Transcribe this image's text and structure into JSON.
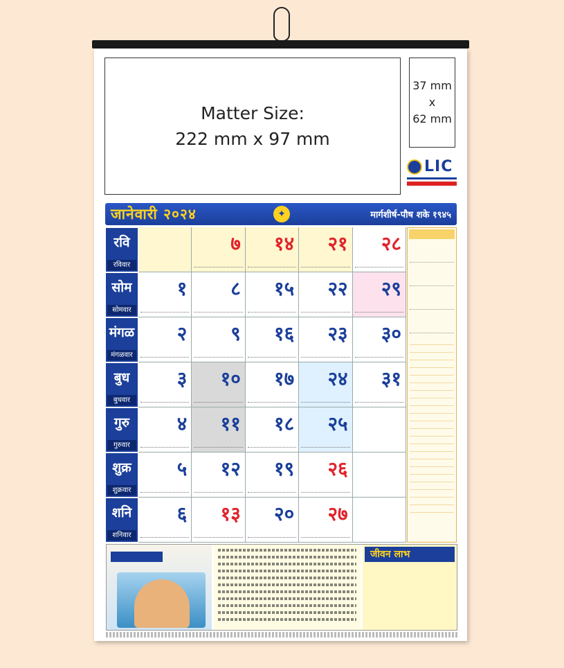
{
  "matter": {
    "line1": "Matter Size:",
    "line2": "222 mm x 97 mm"
  },
  "small_box": {
    "line1": "37 mm",
    "line2": "x",
    "line3": "62 mm"
  },
  "lic": {
    "name": "LIC"
  },
  "header": {
    "month": "जानेवारी २०२४",
    "shaka": "मार्गशीर्ष-पौष शके १९४५"
  },
  "days": [
    {
      "name": "रवि",
      "sub": "रविवार",
      "dates": [
        "",
        "७",
        "१४",
        "२१",
        "२८"
      ]
    },
    {
      "name": "सोम",
      "sub": "सोमवार",
      "dates": [
        "१",
        "८",
        "१५",
        "२२",
        "२९"
      ]
    },
    {
      "name": "मंगळ",
      "sub": "मंगळवार",
      "dates": [
        "२",
        "९",
        "१६",
        "२३",
        "३०"
      ]
    },
    {
      "name": "बुध",
      "sub": "बुधवार",
      "dates": [
        "३",
        "१०",
        "१७",
        "२४",
        "३१"
      ]
    },
    {
      "name": "गुरु",
      "sub": "गुरुवार",
      "dates": [
        "४",
        "११",
        "१८",
        "२५",
        ""
      ]
    },
    {
      "name": "शुक्र",
      "sub": "शुक्रवार",
      "dates": [
        "५",
        "१२",
        "१९",
        "२६",
        ""
      ]
    },
    {
      "name": "शनि",
      "sub": "शनिवार",
      "dates": [
        "६",
        "१३",
        "२०",
        "२७",
        ""
      ]
    }
  ],
  "plan": {
    "title": "जीवन लाभ"
  }
}
